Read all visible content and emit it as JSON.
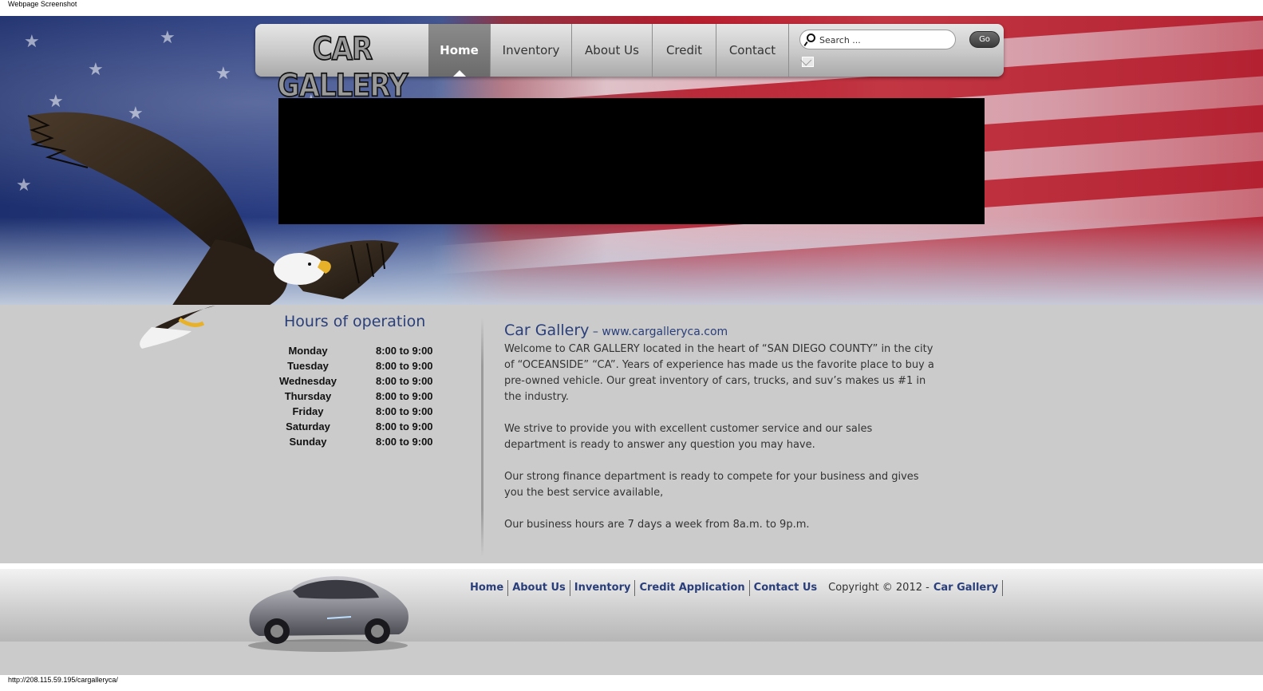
{
  "caption": "Webpage Screenshot",
  "status_url": "http://208.115.59.195/cargalleryca/",
  "logo_text": "CAR GALLERY",
  "nav": {
    "items": [
      {
        "label": "Home",
        "active": true
      },
      {
        "label": "Inventory"
      },
      {
        "label": "About Us"
      },
      {
        "label": "Credit"
      },
      {
        "label": "Contact"
      }
    ],
    "search_placeholder": "Search ...",
    "go_label": "Go"
  },
  "hours": {
    "title": "Hours of operation",
    "rows": [
      {
        "day": "Monday",
        "time": "8:00 to 9:00"
      },
      {
        "day": "Tuesday",
        "time": "8:00 to 9:00"
      },
      {
        "day": "Wednesday",
        "time": "8:00 to 9:00"
      },
      {
        "day": "Thursday",
        "time": "8:00 to 9:00"
      },
      {
        "day": "Friday",
        "time": "8:00 to 9:00"
      },
      {
        "day": "Saturday",
        "time": "8:00 to 9:00"
      },
      {
        "day": "Sunday",
        "time": "8:00 to 9:00"
      }
    ]
  },
  "about": {
    "title": "Car Gallery",
    "separator": " – ",
    "url": "www.cargalleryca.com",
    "paragraphs": [
      "Welcome to CAR GALLERY located in the heart of “SAN DIEGO COUNTY” in the city of “OCEANSIDE” “CA”. Years of experience has made us the favorite place to buy a pre-owned vehicle. Our great inventory of cars, trucks, and suv’s makes us #1 in the industry.",
      "We strive to provide you with excellent customer service and our sales department is ready to answer any question you may have.",
      "Our strong finance department is ready to compete for your business and gives you the best service available,",
      "Our business hours are 7 days a week from 8a.m. to 9p.m."
    ]
  },
  "footer": {
    "links": [
      "Home",
      "About Us",
      "Inventory",
      "Credit Application",
      "Contact Us"
    ],
    "copyright": "Copyright © 2012 - ",
    "brand": "Car Gallery"
  },
  "colors": {
    "link_blue": "#2a3f7a",
    "content_bg": "#cbcbcb"
  }
}
